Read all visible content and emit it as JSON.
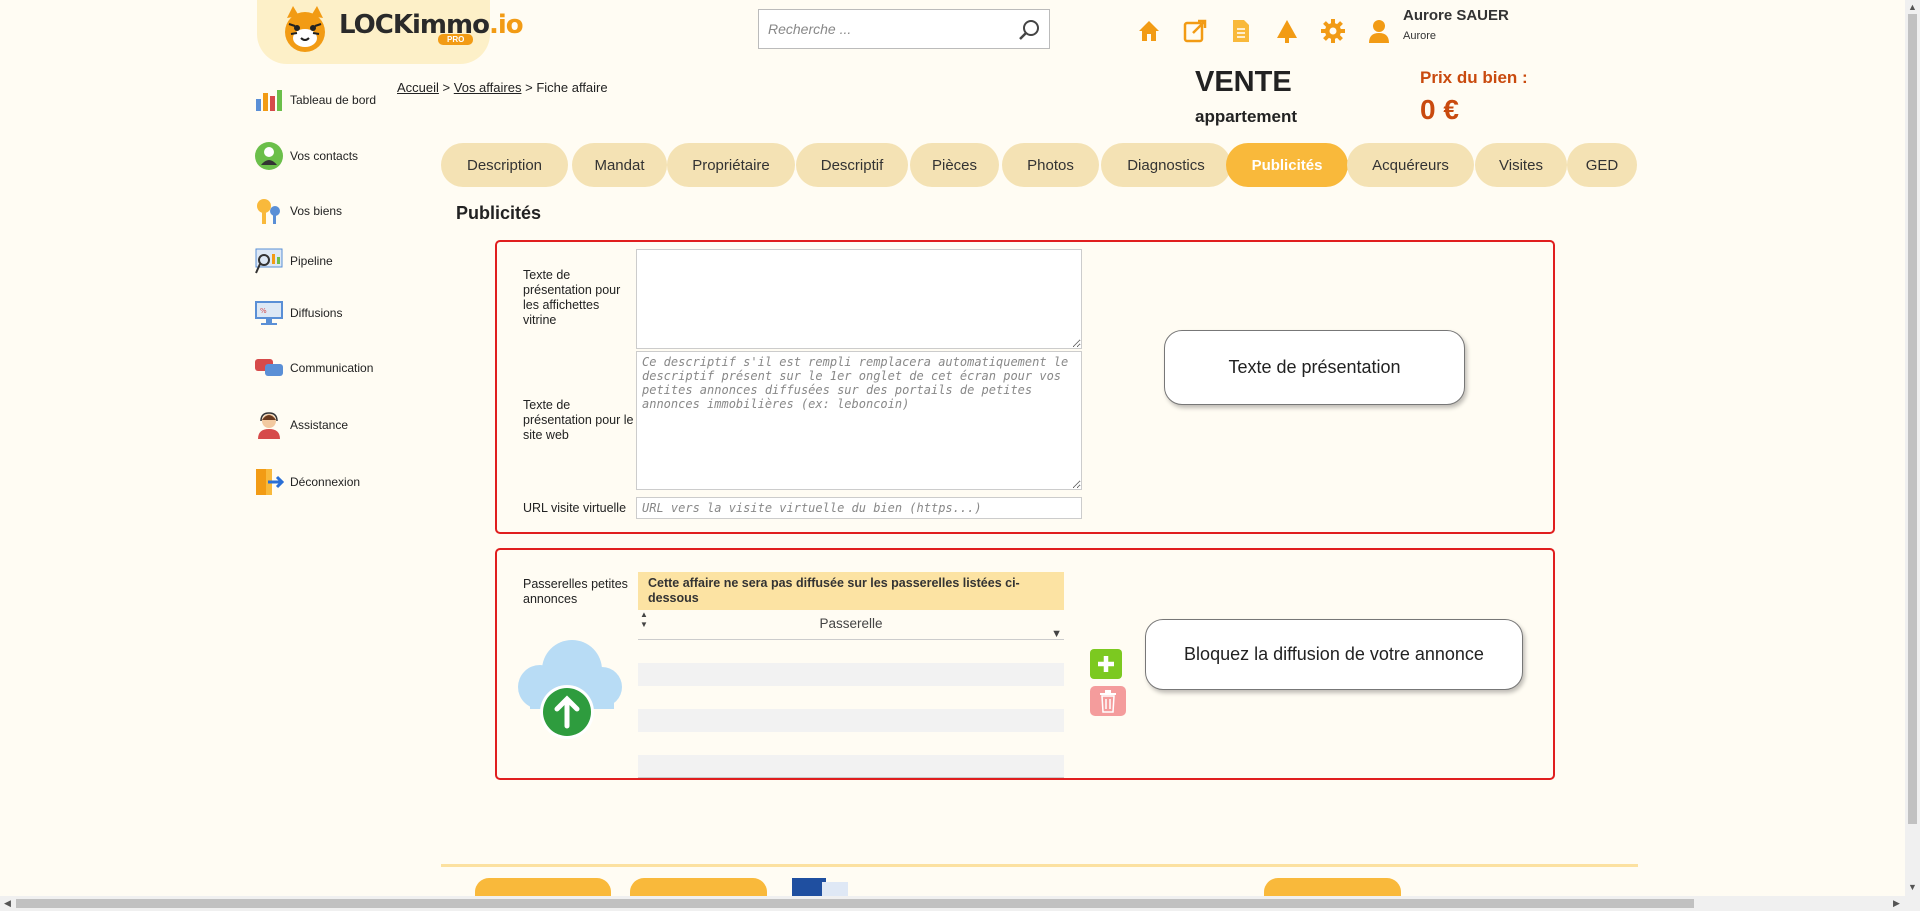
{
  "brand": {
    "name_main": "LOCKimmo",
    "name_suffix": ".io",
    "badge": "PRO",
    "accent": "#f29b14"
  },
  "search": {
    "placeholder": "Recherche ..."
  },
  "header_icons": [
    "home-icon",
    "external-link-icon",
    "document-icon",
    "tree-icon",
    "gear-icon",
    "user-icon"
  ],
  "user": {
    "name": "Aurore SAUER",
    "subtitle": "Aurore"
  },
  "sidebar": {
    "items": [
      {
        "label": "Tableau de bord",
        "icon": "dashboard-icon"
      },
      {
        "label": "Vos contacts",
        "icon": "contacts-icon"
      },
      {
        "label": "Vos biens",
        "icon": "keys-icon"
      },
      {
        "label": "Pipeline",
        "icon": "pipeline-icon"
      },
      {
        "label": "Diffusions",
        "icon": "diffusion-icon"
      },
      {
        "label": "Communication",
        "icon": "chat-icon"
      },
      {
        "label": "Assistance",
        "icon": "support-icon"
      },
      {
        "label": "Déconnexion",
        "icon": "logout-icon"
      }
    ]
  },
  "breadcrumb": {
    "home": "Accueil",
    "sep1": ">",
    "affaires": "Vos affaires",
    "sep2": ">",
    "current": "Fiche affaire"
  },
  "affaire": {
    "type": "VENTE",
    "subtype": "appartement",
    "price_label": "Prix du bien :",
    "price_value": "0 €"
  },
  "tabs": [
    {
      "label": "Description",
      "active": false
    },
    {
      "label": "Mandat",
      "active": false
    },
    {
      "label": "Propriétaire",
      "active": false
    },
    {
      "label": "Descriptif",
      "active": false
    },
    {
      "label": "Pièces",
      "active": false
    },
    {
      "label": "Photos",
      "active": false
    },
    {
      "label": "Diagnostics",
      "active": false
    },
    {
      "label": "Publicités",
      "active": true
    },
    {
      "label": "Acquéreurs",
      "active": false
    },
    {
      "label": "Visites",
      "active": false
    },
    {
      "label": "GED",
      "active": false
    }
  ],
  "section_title": "Publicités",
  "form": {
    "vitrine_label": "Texte de présentation pour les affichettes vitrine",
    "vitrine_value": "",
    "web_label": "Texte de présentation pour le site web",
    "web_placeholder": "Ce descriptif s'il est rempli remplacera automatiquement le descriptif présent sur le 1er onglet de cet écran pour vos petites annonces diffusées sur des portails de petites annonces immobilières (ex: leboncoin)",
    "url_label": "URL visite virtuelle",
    "url_placeholder": "URL vers la visite virtuelle du bien (https...)"
  },
  "callouts": {
    "presentation": "Texte de présentation",
    "diffusion": "Bloquez la diffusion de votre annonce"
  },
  "passerelles": {
    "label": "Passerelles petites annonces",
    "table_header": "Cette affaire ne sera pas diffusée sur les passerelles listées ci-dessous",
    "column": "Passerelle",
    "rows": []
  },
  "colors": {
    "tab": "#f4e2b4",
    "tab_active": "#f9b93b",
    "price": "#c94a0e",
    "panel_border": "#e01e1e",
    "add_button": "#7cc920",
    "delete_button": "#f49c9c"
  }
}
